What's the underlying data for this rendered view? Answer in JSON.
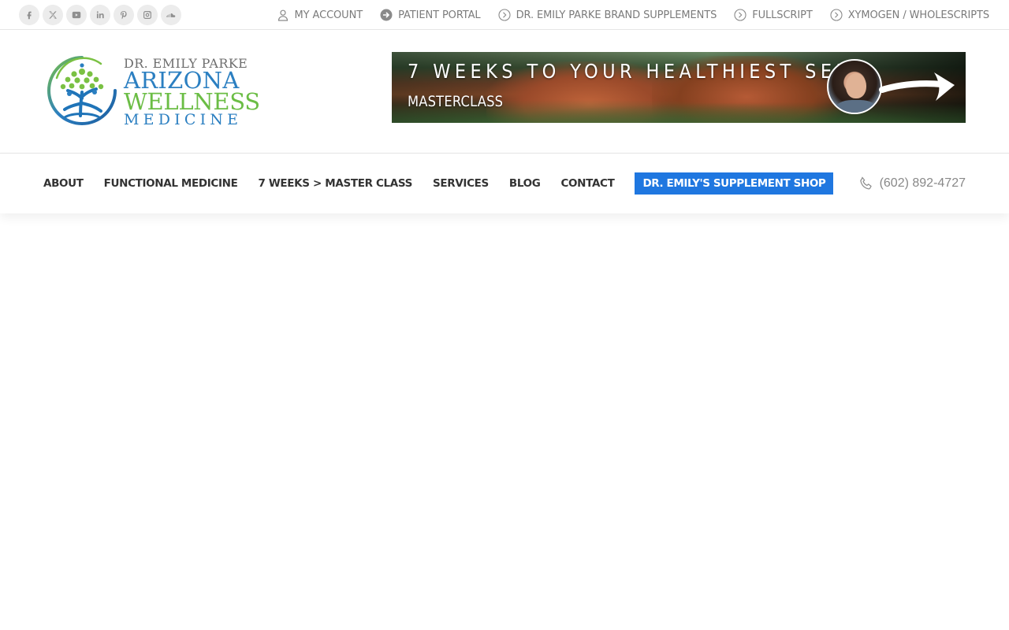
{
  "topbar": {
    "socials": [
      "facebook-icon",
      "x-twitter-icon",
      "youtube-icon",
      "linkedin-icon",
      "pinterest-icon",
      "instagram-icon",
      "soundcloud-icon"
    ],
    "links": [
      {
        "label": "MY ACCOUNT",
        "icon": "user-icon"
      },
      {
        "label": "PATIENT PORTAL",
        "icon": "arrow-circle-icon"
      },
      {
        "label": "DR. EMILY PARKE BRAND SUPPLEMENTS",
        "icon": "chevron-circle-icon"
      },
      {
        "label": "FULLSCRIPT",
        "icon": "chevron-circle-icon"
      },
      {
        "label": "XYMOGEN / WHOLESCRIPTS",
        "icon": "chevron-circle-icon"
      }
    ]
  },
  "logo": {
    "line1": "DR. EMILY PARKE",
    "line2": "ARIZONA",
    "line3": "WELLNESS",
    "line4": "MEDICINE"
  },
  "banner": {
    "title": "7 WEEKS TO YOUR HEALTHIEST SELF",
    "subtitle": "MASTERCLASS"
  },
  "nav": {
    "items": [
      "ABOUT",
      "FUNCTIONAL MEDICINE",
      "7 WEEKS > MASTER CLASS",
      "SERVICES",
      "BLOG",
      "CONTACT"
    ],
    "shop": "DR. EMILY'S SUPPLEMENT SHOP",
    "phone": "(602) 892-4727"
  },
  "colors": {
    "accent_blue": "#1f77e0",
    "logo_blue": "#2b7fc1",
    "logo_green": "#6bbd45",
    "topbar_text": "#7b7b7b"
  }
}
